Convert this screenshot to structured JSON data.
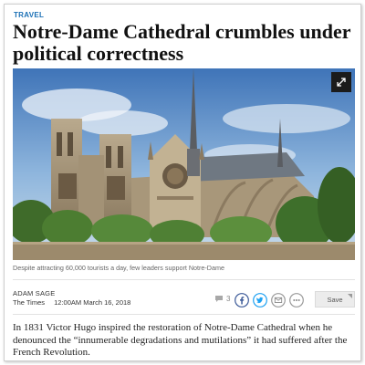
{
  "article": {
    "section": "TRAVEL",
    "headline": "Notre-Dame Cathedral crumbles under political correctness",
    "image_caption": "Despite attracting 60,000 tourists a day, few leaders support Notre-Dame",
    "author": "ADAM SAGE",
    "publication": "The Times",
    "published": "12:00AM March 16, 2018",
    "comment_count": "3",
    "save_label": "Save",
    "body": "In 1831 Victor Hugo inspired the restoration of Notre-Dame Cathedral when he denounced the “innumerable degradations and mutilations” it had suffered after the French Revolution."
  },
  "icons": {
    "expand": "expand-icon",
    "comment": "comment-icon",
    "facebook": "facebook-icon",
    "twitter": "twitter-icon",
    "email": "email-icon",
    "more": "more-icon"
  },
  "colors": {
    "section": "#1a6fb5",
    "facebook": "#3b5998",
    "twitter": "#1da1f2"
  }
}
